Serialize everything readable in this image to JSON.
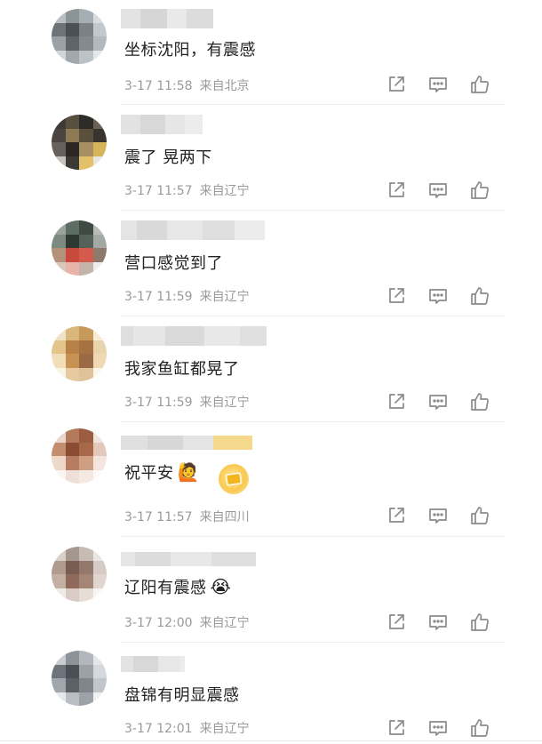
{
  "comments": [
    {
      "text": "坐标沈阳，有震感",
      "time": "3-17 11:58",
      "location": "来自北京",
      "emoji": ""
    },
    {
      "text": "震了 晃两下",
      "time": "3-17 11:57",
      "location": "来自辽宁",
      "emoji": ""
    },
    {
      "text": "营口感觉到了",
      "time": "3-17 11:59",
      "location": "来自辽宁",
      "emoji": ""
    },
    {
      "text": "我家鱼缸都晃了",
      "time": "3-17 11:59",
      "location": "来自辽宁",
      "emoji": ""
    },
    {
      "text": "祝平安",
      "time": "3-17 11:57",
      "location": "来自四川",
      "emoji": "🙋"
    },
    {
      "text": "辽阳有震感",
      "time": "3-17 12:00",
      "location": "来自辽宁",
      "emoji": "😭"
    },
    {
      "text": "盘锦有明显震感",
      "time": "3-17 12:01",
      "location": "来自辽宁",
      "emoji": ""
    }
  ],
  "icons": {
    "share": "share-icon",
    "reply": "comment-icon",
    "like": "thumbs-up-icon"
  },
  "colors": {
    "text": "#222222",
    "meta": "#9a9a9a",
    "icon": "#8a8a8a",
    "divider": "#ededed"
  }
}
